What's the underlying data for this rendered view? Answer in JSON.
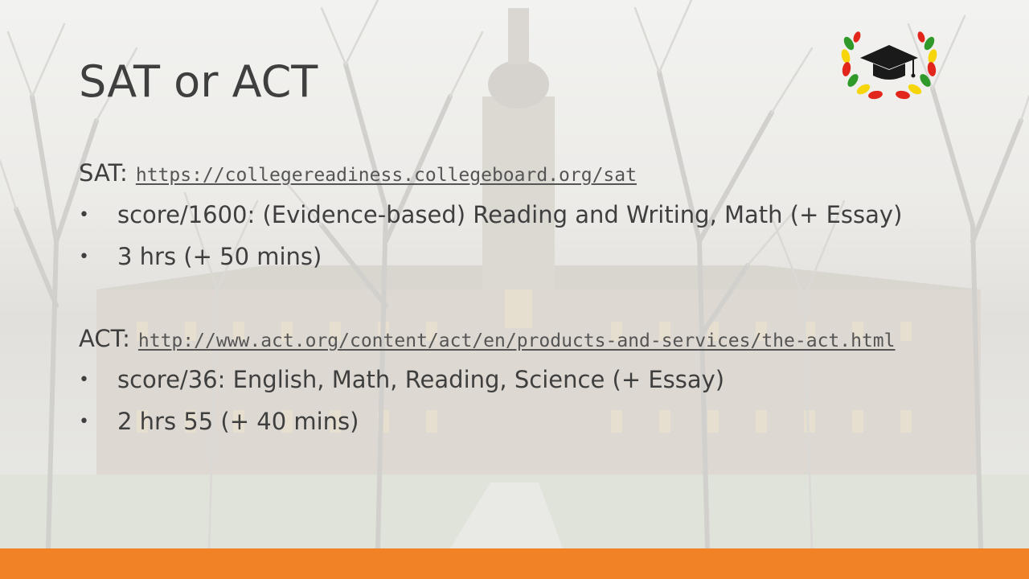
{
  "slide": {
    "title": "SAT or ACT",
    "sat": {
      "prefix": "SAT:",
      "link": "https://collegereadiness.collegeboard.org/sat",
      "bullets": [
        "score/1600: (Evidence-based) Reading and Writing, Math (+ Essay)",
        "3 hrs (+ 50 mins)"
      ]
    },
    "act": {
      "prefix": "ACT:",
      "link": "http://www.act.org/content/act/en/products-and-services/the-act.html",
      "bullets": [
        "score/36: English, Math, Reading, Science (+ Essay)",
        "2 hrs 55 (+ 40 mins)"
      ]
    },
    "bullet_char": "•"
  },
  "icons": {
    "logo": "graduation-cap-laurel-icon"
  },
  "colors": {
    "accent_bar": "#f28226",
    "text": "#3f3f3f",
    "laurel_red": "#e2261c",
    "laurel_yellow": "#f6d60a",
    "laurel_green": "#2f9a2a"
  }
}
